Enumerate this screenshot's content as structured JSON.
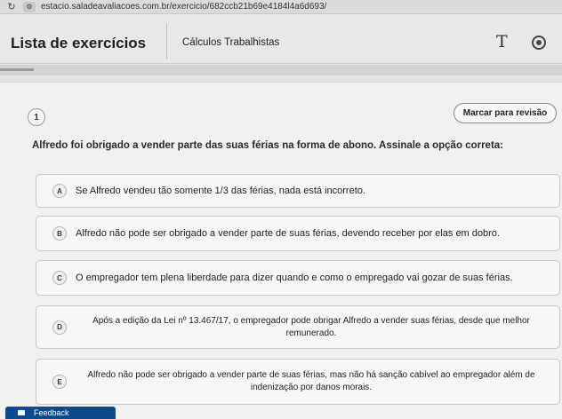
{
  "browser": {
    "reload_icon": "↻",
    "site_icon": "⚙",
    "url": "estacio.saladeavaliacoes.com.br/exercicio/682ccb21b69e4184l4a6d693/"
  },
  "header": {
    "title": "Lista de exercícios",
    "course": "Cálculos Trabalhistas",
    "font_icon": "T"
  },
  "progress": {
    "fraction": 0.06
  },
  "question": {
    "number": "1",
    "review_label": "Marcar para revisão",
    "stem": "Alfredo foi obrigado a vender parte das suas férias na forma de abono. Assinale a opção correta:",
    "options": [
      {
        "letter": "A",
        "text": "Se Alfredo vendeu tão somente 1/3 das férias, nada está incorreto."
      },
      {
        "letter": "B",
        "text": "Alfredo não pode ser obrigado a vender parte de suas férias, devendo receber por elas em dobro."
      },
      {
        "letter": "C",
        "text": "O empregador tem plena liberdade para dizer quando e como o empregado vai gozar de suas férias."
      },
      {
        "letter": "D",
        "text": "Após a edição da Lei nº 13.467/17, o empregador pode obrigar Alfredo a vender suas férias, desde que melhor remunerado."
      },
      {
        "letter": "E",
        "text": "Alfredo não pode ser obrigado a vender parte de suas férias, mas não há sanção cabível ao empregador além de indenização por danos morais."
      }
    ]
  },
  "footer": {
    "feedback_label": "Feedback"
  }
}
